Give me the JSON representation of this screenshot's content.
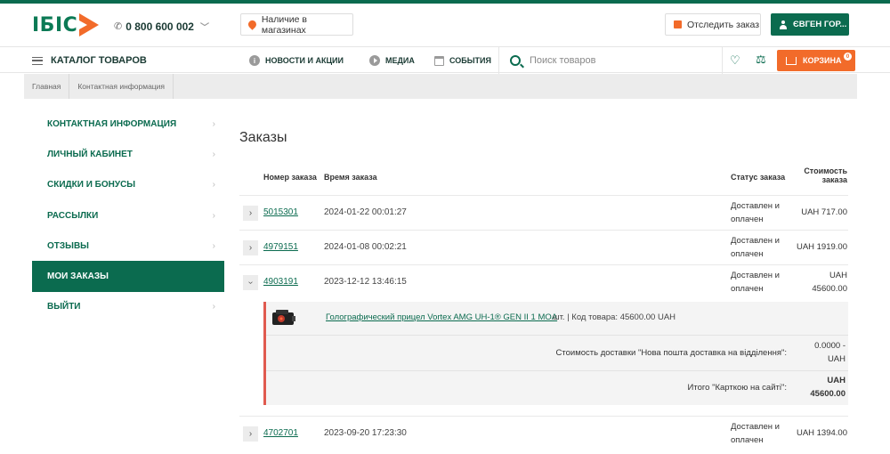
{
  "header": {
    "logo": "ІБІС",
    "phone": "0 800 600 002",
    "stores_button": "Наличие в магазинах",
    "track_button": "Отследить заказ",
    "user_button": "ЄВГЕН ГОР..."
  },
  "nav": {
    "catalog": "КАТАЛОГ ТОВАРОВ",
    "news": "НОВОСТИ И АКЦИИ",
    "media": "МЕДИА",
    "events": "СОБЫТИЯ",
    "search_placeholder": "Поиск товаров",
    "cart": "КОРЗИНА",
    "cart_count": "0"
  },
  "breadcrumb": [
    "Главная",
    "Контактная информация"
  ],
  "sidebar": {
    "items": [
      {
        "label": "КОНТАКТНАЯ ИНФОРМАЦИЯ",
        "active": false
      },
      {
        "label": "ЛИЧНЫЙ КАБИНЕТ",
        "active": false
      },
      {
        "label": "СКИДКИ И БОНУСЫ",
        "active": false
      },
      {
        "label": "РАССЫЛКИ",
        "active": false
      },
      {
        "label": "ОТЗЫВЫ",
        "active": false
      },
      {
        "label": "МОИ ЗАКАЗЫ",
        "active": true
      },
      {
        "label": "ВЫЙТИ",
        "active": false
      }
    ]
  },
  "orders": {
    "title": "Заказы",
    "columns": {
      "number": "Номер заказа",
      "time": "Время заказа",
      "status": "Статус заказа",
      "cost_line1": "Стоимость",
      "cost_line2": "заказа"
    },
    "rows": [
      {
        "number": "5015301",
        "time": "2024-01-22 00:01:27",
        "status_line1": "Доставлен и",
        "status_line2": "оплачен",
        "cost_line1": "UAH 717.00",
        "cost_line2": "",
        "expanded": false
      },
      {
        "number": "4979151",
        "time": "2024-01-08 00:02:21",
        "status_line1": "Доставлен и",
        "status_line2": "оплачен",
        "cost_line1": "UAH 1919.00",
        "cost_line2": "",
        "expanded": false
      },
      {
        "number": "4903191",
        "time": "2023-12-12 13:46:15",
        "status_line1": "Доставлен и",
        "status_line2": "оплачен",
        "cost_line1": "UAH",
        "cost_line2": "45600.00",
        "expanded": true
      },
      {
        "number": "4702701",
        "time": "2023-09-20 17:23:30",
        "status_line1": "Доставлен и",
        "status_line2": "оплачен",
        "cost_line1": "UAH 1394.00",
        "cost_line2": "",
        "expanded": false
      }
    ],
    "detail": {
      "item_name": "Голографический прицел Vortex AMG UH-1® GEN II 1 MOA",
      "item_rest": "шт. | Код товара: 45600.00 UAH",
      "shipping_label": "Стоимость доставки \"Нова пошта доставка на відділення\":",
      "shipping_value_line1": "0.0000 -",
      "shipping_value_line2": "UAH",
      "total_label": "Итого \"Карткою на сайті\":",
      "total_value_line1": "UAH",
      "total_value_line2": "45600.00"
    }
  }
}
